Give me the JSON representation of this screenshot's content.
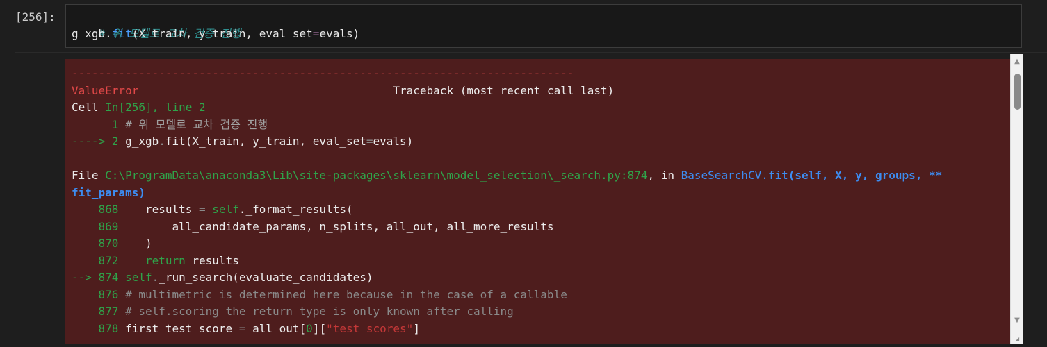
{
  "cell": {
    "prompt": "[256]:",
    "input_lines": [
      {
        "comment": "# 위 모델로 교차 검증 진행"
      },
      {
        "var": "g_xgb.",
        "fn": "fit",
        "args_a": "(X_train, y_train, eval_set",
        "eq": "=",
        "args_b": "evals)"
      }
    ]
  },
  "traceback": {
    "dashes": "---------------------------------------------------------------------------",
    "error_type": "ValueError",
    "header_right": "Traceback (most recent call last)",
    "cell_prefix": "Cell ",
    "cell_ref": "In[256], line 2",
    "line1_no": "      1 ",
    "line1_text": "# 위 모델로 교차 검증 진행",
    "arrow2": "----> 2 ",
    "line2_var": "g_xgb",
    "line2_dot": ".",
    "line2_rest": "fit(X_train, y_train, eval_set",
    "line2_eq": "=",
    "line2_end": "evals)",
    "file_prefix": "File ",
    "file_path": "C:\\ProgramData\\anaconda3\\Lib\\site-packages\\sklearn\\model_selection\\_search.py:874",
    "file_in": ", in ",
    "file_func": "BaseSearchCV.fit",
    "file_sig1": "(self, X, y, groups, **",
    "file_sig2": "fit_params)",
    "code": [
      {
        "no": "    868 ",
        "pre": "   ",
        "a": "results ",
        "b": "= ",
        "c": "self",
        "d": "._format_results("
      },
      {
        "no": "    869 ",
        "text": "       all_candidate_params, n_splits, all_out, all_more_results"
      },
      {
        "no": "    870 ",
        "text": "   )"
      },
      {
        "no": "    872 ",
        "kw": "   return",
        "rest": " results"
      }
    ],
    "arrow874": "--> 874 ",
    "line874_self": "self",
    "line874_dot": ".",
    "line874_rest": "_run_search(evaluate_candidates)",
    "line876_no": "    876 ",
    "line876_text": "# multimetric is determined here because in the case of a callable",
    "line877_no": "    877 ",
    "line877_text": "# self.scoring the return type is only known after calling",
    "line878_no": "    878 ",
    "line878_a": "first_test_score ",
    "line878_eq": "=",
    "line878_b": " all_out[",
    "line878_idx": "0",
    "line878_c": "][",
    "line878_str": "\"test_scores\"",
    "line878_d": "]"
  },
  "scrollbar": {
    "up": "▲",
    "down": "▼",
    "corner": "◢"
  }
}
